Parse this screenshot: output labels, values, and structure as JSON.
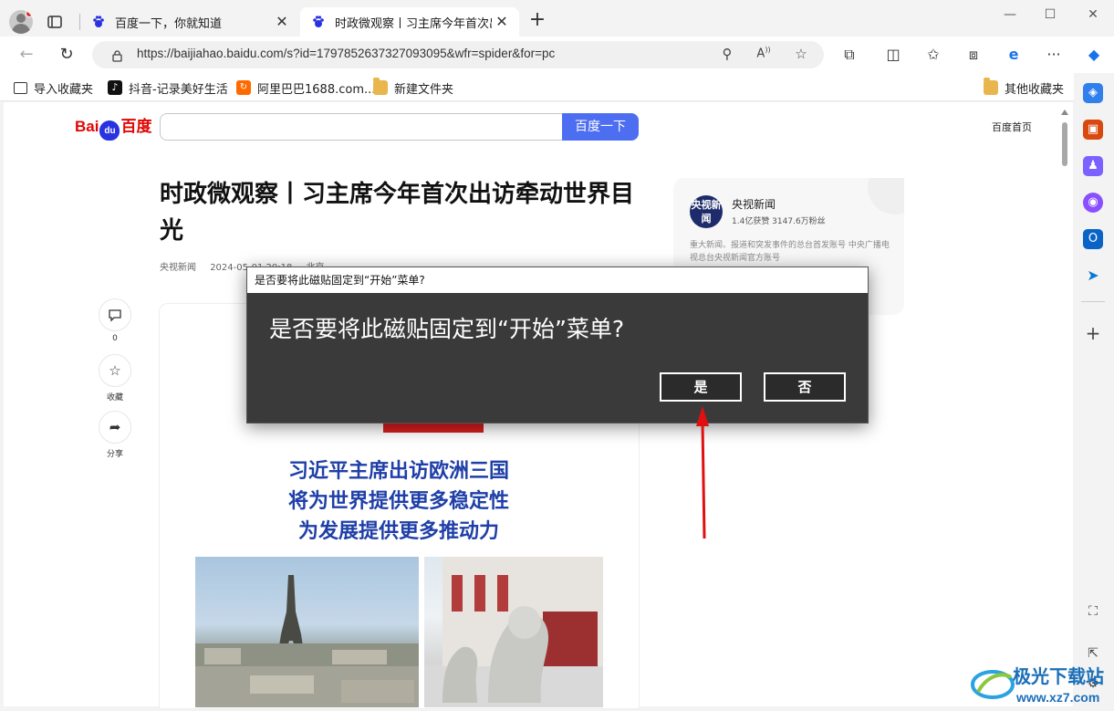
{
  "browser": {
    "tabs": [
      {
        "title": "百度一下，你就知道"
      },
      {
        "title": "时政微观察丨习主席今年首次出访牵动世界目光"
      }
    ],
    "address_url": "https://baijiahao.baidu.com/s?id=1797852637327093095&wfr=spider&for=pc",
    "bookmarks": [
      {
        "label": "导入收藏夹"
      },
      {
        "label": "抖音-记录美好生活"
      },
      {
        "label": "阿里巴巴1688.com..."
      },
      {
        "label": "新建文件夹"
      },
      {
        "label": "其他收藏夹"
      }
    ]
  },
  "page": {
    "search_button": "百度一下",
    "home_link": "百度首页",
    "headline": "时政微观察丨习主席今年首次出访牵动世界目光",
    "source": "央视新闻",
    "datetime": "2024-05-01 20:18",
    "location": "北京",
    "comment_count": "0",
    "favorite_label": "收藏",
    "share_label": "分享",
    "article_image_lines": [
      "习近平主席出访欧洲三国",
      "将为世界提供更多稳定性",
      "为发展提供更多推动力"
    ],
    "author": {
      "avatar_text": "央视新闻",
      "name": "央视新闻",
      "stats": "1.4亿获赞 3147.6万粉丝",
      "desc": "重大新闻、报道和突发事件的总台首发账号 中央广播电视总台央视新闻官方账号"
    }
  },
  "dialog": {
    "title": "是否要将此磁贴固定到“开始”菜单?",
    "message": "是否要将此磁贴固定到“开始”菜单?",
    "yes": "是",
    "no": "否"
  },
  "watermark": {
    "line1": "极光下载站",
    "line2": "www.xz7.com"
  },
  "colors": {
    "baidu_blue": "#4e6ef2",
    "baidu_red": "#e10602",
    "dialog_bg": "#3a3a3a",
    "arrow_red": "#e01010"
  }
}
